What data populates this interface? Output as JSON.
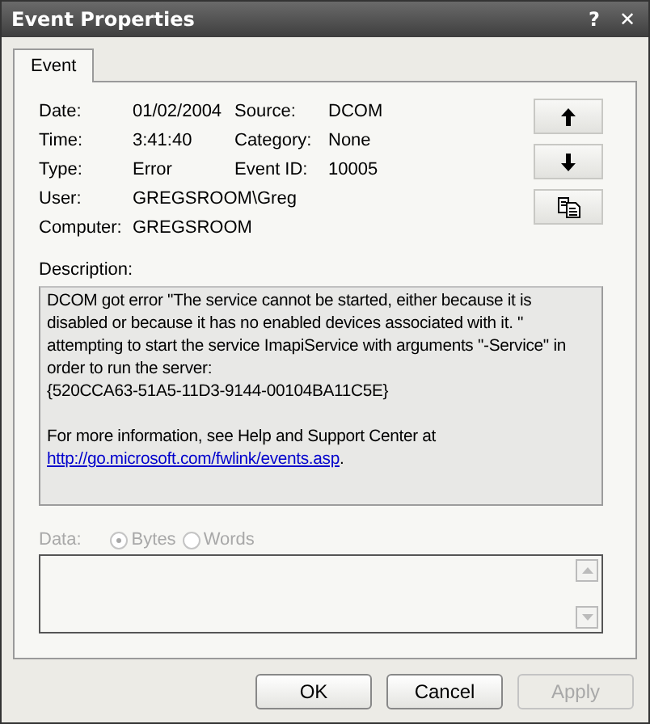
{
  "window": {
    "title": "Event Properties",
    "help": "?",
    "close": "✕"
  },
  "tabs": [
    {
      "label": "Event",
      "selected": true
    }
  ],
  "fields": [
    {
      "label": "Date:",
      "value": "01/02/2004"
    },
    {
      "label": "Source:",
      "value": "DCOM"
    },
    {
      "label": "Time:",
      "value": "3:41:40"
    },
    {
      "label": "Category:",
      "value": "None"
    },
    {
      "label": "Type:",
      "value": "Error"
    },
    {
      "label": "Event ID:",
      "value": "10005"
    },
    {
      "label": "User:",
      "value": "GREGSROOM\\Greg"
    },
    {
      "label": "Computer:",
      "value": "GREGSROOM"
    }
  ],
  "side_buttons": [
    {
      "kind": "up"
    },
    {
      "kind": "down"
    },
    {
      "kind": "copy"
    }
  ],
  "description": {
    "label": "Description:",
    "paragraphs": [
      "DCOM got error \"The service cannot be started, either because it is disabled or because it has no enabled devices associated with it. \" attempting to start the service ImapiService with arguments \"-Service\" in order to run the server:",
      "{520CCA63-51A5-11D3-9144-00104BA11C5E}"
    ],
    "more_info": "For more information, see Help and Support Center at",
    "link": "http://go.microsoft.com/fwlink/events.asp",
    "after_link": "."
  },
  "data": {
    "label": "Data:",
    "disabled": true,
    "options": [
      {
        "label": "Bytes",
        "selected": true
      },
      {
        "label": "Words",
        "selected": false
      }
    ]
  },
  "buttons": [
    {
      "label": "OK",
      "disabled": false
    },
    {
      "label": "Cancel",
      "disabled": false
    },
    {
      "label": "Apply",
      "disabled": true
    }
  ]
}
